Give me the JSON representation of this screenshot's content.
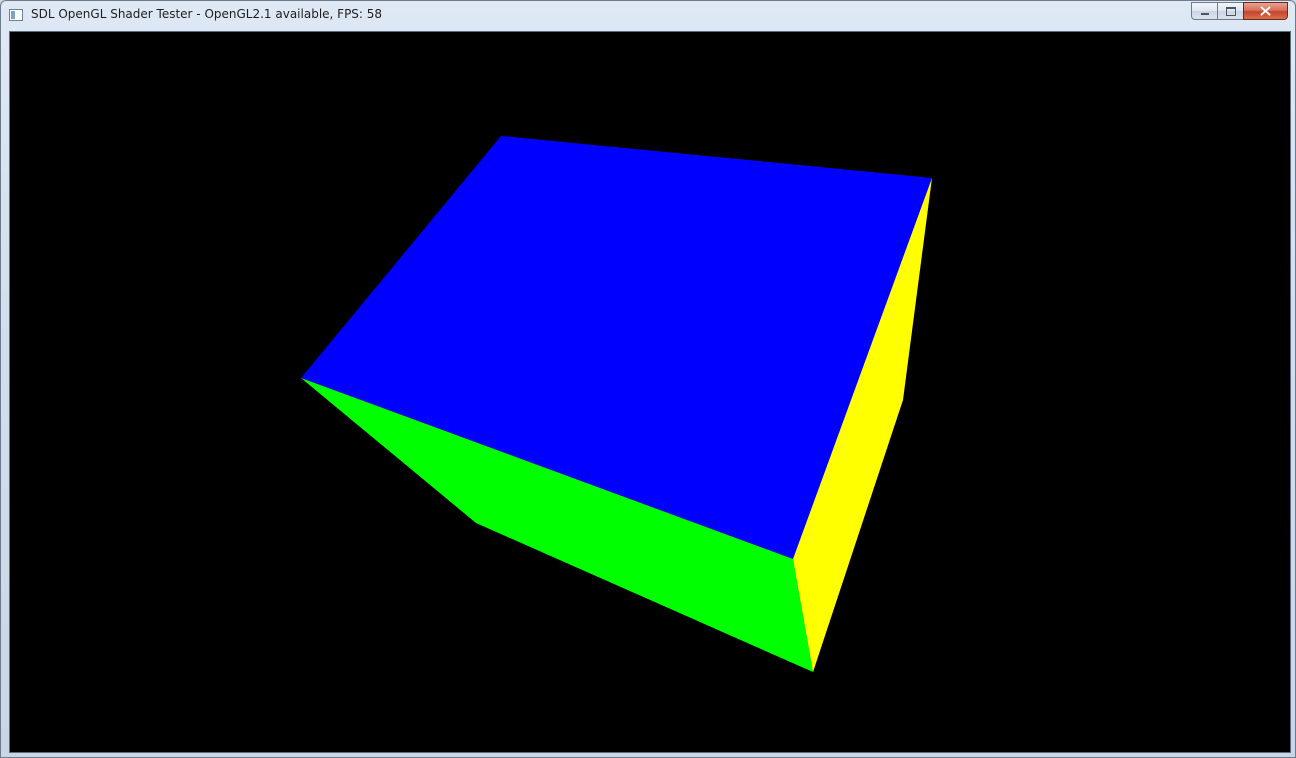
{
  "window": {
    "title": "SDL OpenGL Shader Tester - OpenGL2.1 available, FPS: 58",
    "icon": "app-window-icon",
    "buttons": {
      "minimize_icon": "minimize-icon",
      "maximize_icon": "maximize-icon",
      "close_icon": "close-icon"
    }
  },
  "scene": {
    "background": "#000000",
    "faces": [
      {
        "name": "cube-face-top",
        "color": "#0000ff"
      },
      {
        "name": "cube-face-front",
        "color": "#00ff00"
      },
      {
        "name": "cube-face-side",
        "color": "#ffff00"
      }
    ]
  }
}
